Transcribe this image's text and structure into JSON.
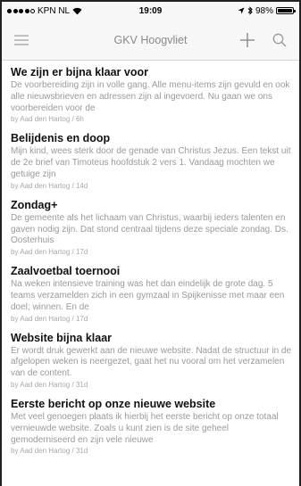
{
  "status_bar": {
    "carrier": "KPN NL",
    "time": "19:09",
    "battery": "98%",
    "battery_level": 0.98,
    "signal_bars": 4
  },
  "nav": {
    "title": "GKV Hoogvliet",
    "menu_icon": "hamburger-menu-icon",
    "add_icon": "plus-icon",
    "search_icon": "search-icon",
    "tint_color": "#9a9a9a"
  },
  "posts": [
    {
      "title": "We zijn er bijna klaar voor",
      "excerpt": "De voorbereiding zijn in volle gang. Alle menu-items zijn gevuld en ook alle nieuwsbrieven en adressen zijn al ingevoerd. Nu gaan we ons voorbereiden voor de",
      "meta": "by Aad den Hartog / 6h"
    },
    {
      "title": "Belijdenis en doop",
      "excerpt": "Mijn kind, wees sterk door de genade van Christus Jezus. Een tekst uit de 2e brief van Timoteus hoofdstuk 2 vers 1. Vandaag mochten we getuige zijn",
      "meta": "by Aad den Hartog / 14d"
    },
    {
      "title": "Zondag+",
      "excerpt": "De gemeente als het lichaam van Christus, waarbij ieders talenten en gaven nodig zijn. Dat stond centraal tijdens deze speciale zondag. Ds. Oosterhuis",
      "meta": "by Aad den Hartog / 17d"
    },
    {
      "title": "Zaalvoetbal toernooi",
      "excerpt": "Na weken intensieve training was het dan eindelijk de grote dag. 5 teams verzamelden zich in een gymzaal in Spijkenisse met maar een doel; winnen. En de",
      "meta": "by Aad den Hartog / 17d"
    },
    {
      "title": "Website bijna klaar",
      "excerpt": "Er wordt druk gewerkt aan de nieuwe website. Nadat de structuur in de afgelopen weken is neergezet, gaat het nu vooral om het verzamelen van de content.",
      "meta": "by Aad den Hartog / 31d"
    },
    {
      "title": "Eerste bericht op onze nieuwe website",
      "excerpt": "Met veel genoegen plaats ik hierbij het eerste bericht op onze totaal vernieuwde website. Zoals u kunt zien is de site geheel gemoderniseerd en zijn vele nieuwe",
      "meta": "by Aad den Hartog / 31d"
    }
  ]
}
